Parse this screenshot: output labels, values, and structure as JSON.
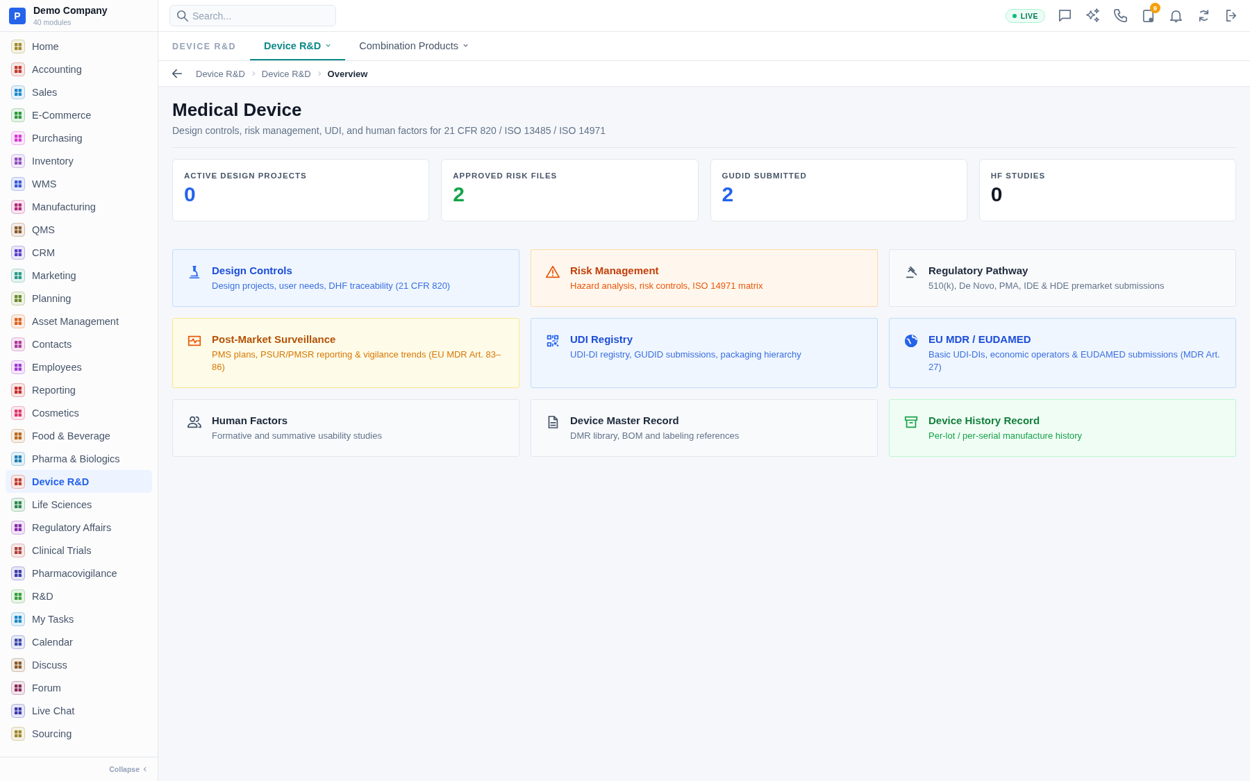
{
  "company": {
    "logo": "P",
    "name": "Demo Company",
    "subtitle": "40 modules"
  },
  "sidebar": {
    "items": [
      {
        "label": "Home",
        "color": "#a08a2a",
        "selected": false
      },
      {
        "label": "Accounting",
        "color": "#c0392b",
        "selected": false
      },
      {
        "label": "Sales",
        "color": "#1e88c8",
        "selected": false
      },
      {
        "label": "E-Commerce",
        "color": "#2e9a3e",
        "selected": false
      },
      {
        "label": "Purchasing",
        "color": "#d63ad6",
        "selected": false
      },
      {
        "label": "Inventory",
        "color": "#8e4fc0",
        "selected": false
      },
      {
        "label": "WMS",
        "color": "#3b5bdb",
        "selected": false
      },
      {
        "label": "Manufacturing",
        "color": "#b5277a",
        "selected": false
      },
      {
        "label": "QMS",
        "color": "#8a5a2b",
        "selected": false
      },
      {
        "label": "CRM",
        "color": "#5b3fc4",
        "selected": false
      },
      {
        "label": "Marketing",
        "color": "#2a9a8a",
        "selected": false
      },
      {
        "label": "Planning",
        "color": "#6a8a2a",
        "selected": false
      },
      {
        "label": "Asset Management",
        "color": "#e0601a",
        "selected": false
      },
      {
        "label": "Contacts",
        "color": "#b03a9a",
        "selected": false
      },
      {
        "label": "Employees",
        "color": "#a03ad6",
        "selected": false
      },
      {
        "label": "Reporting",
        "color": "#c62828",
        "selected": false
      },
      {
        "label": "Cosmetics",
        "color": "#e0336a",
        "selected": false
      },
      {
        "label": "Food & Beverage",
        "color": "#b8681a",
        "selected": false
      },
      {
        "label": "Pharma & Biologics",
        "color": "#1e7fb8",
        "selected": false
      },
      {
        "label": "Device R&D",
        "color": "#c0392b",
        "selected": true
      },
      {
        "label": "Life Sciences",
        "color": "#2e8a4e",
        "selected": false
      },
      {
        "label": "Regulatory Affairs",
        "color": "#8a2ab0",
        "selected": false
      },
      {
        "label": "Clinical Trials",
        "color": "#b0403a",
        "selected": false
      },
      {
        "label": "Pharmacovigilance",
        "color": "#3a3ab0",
        "selected": false
      },
      {
        "label": "R&D",
        "color": "#3aa03a",
        "selected": false
      },
      {
        "label": "My Tasks",
        "color": "#1e88c8",
        "selected": false
      },
      {
        "label": "Calendar",
        "color": "#3a4ab0",
        "selected": false
      },
      {
        "label": "Discuss",
        "color": "#8a5a2b",
        "selected": false
      },
      {
        "label": "Forum",
        "color": "#8a2a5a",
        "selected": false
      },
      {
        "label": "Live Chat",
        "color": "#3a3ab0",
        "selected": false
      },
      {
        "label": "Sourcing",
        "color": "#a08a2a",
        "selected": false
      }
    ],
    "footer": "Collapse"
  },
  "topbar": {
    "search": {
      "placeholder": "Search..."
    },
    "live": "LIVE",
    "badge": "9"
  },
  "tabs": {
    "section": "DEVICE R&D",
    "items": [
      {
        "label": "Device R&D",
        "selected": true
      },
      {
        "label": "Combination Products",
        "selected": false
      }
    ]
  },
  "breadcrumb": [
    "Device R&D",
    "Device R&D",
    "Overview"
  ],
  "page": {
    "title": "Medical Device",
    "subtitle": "Design controls, risk management, UDI, and human factors for 21 CFR 820 / ISO 13485 / ISO 14971"
  },
  "stats": [
    {
      "label": "ACTIVE DESIGN PROJECTS",
      "value": "0",
      "color": "#2563eb"
    },
    {
      "label": "APPROVED RISK FILES",
      "value": "2",
      "color": "#16a34a"
    },
    {
      "label": "GUDID SUBMITTED",
      "value": "2",
      "color": "#2563eb"
    },
    {
      "label": "HF STUDIES",
      "value": "0",
      "color": "#111827"
    }
  ],
  "cards": [
    {
      "kind": "blue",
      "title": "Design Controls",
      "description": "Design projects, user needs, DHF traceability (21 CFR 820)"
    },
    {
      "kind": "orange",
      "title": "Risk Management",
      "description": "Hazard analysis, risk controls, ISO 14971 matrix"
    },
    {
      "kind": "neutral",
      "title": "Regulatory Pathway",
      "description": "510(k), De Novo, PMA, IDE & HDE premarket submissions"
    },
    {
      "kind": "yellow",
      "title": "Post-Market Surveillance",
      "description": "PMS plans, PSUR/PMSR reporting & vigilance trends (EU MDR Art. 83–86)"
    },
    {
      "kind": "blue",
      "title": "UDI Registry",
      "description": "UDI-DI registry, GUDID submissions, packaging hierarchy"
    },
    {
      "kind": "blue",
      "title": "EU MDR / EUDAMED",
      "description": "Basic UDI-DIs, economic operators & EUDAMED submissions (MDR Art. 27)"
    },
    {
      "kind": "neutral",
      "title": "Human Factors",
      "description": "Formative and summative usability studies"
    },
    {
      "kind": "neutral",
      "title": "Device Master Record",
      "description": "DMR library, BOM and labeling references"
    },
    {
      "kind": "green",
      "title": "Device History Record",
      "description": "Per-lot / per-serial manufacture history"
    }
  ]
}
